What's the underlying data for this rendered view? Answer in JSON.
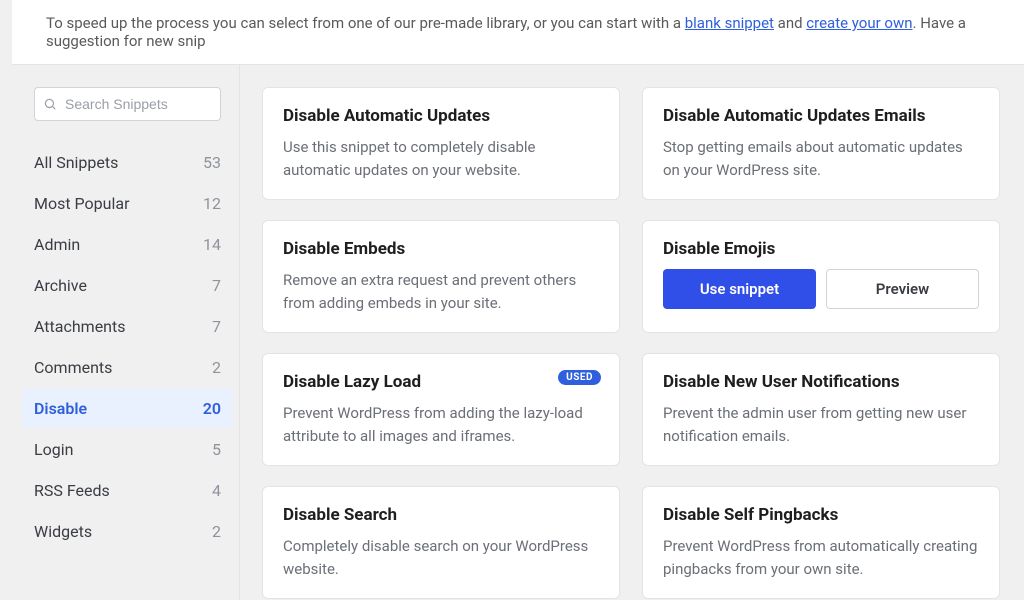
{
  "banner": {
    "prefix": "To speed up the process you can select from one of our pre-made library, or you can start with a ",
    "link1": "blank snippet",
    "mid": " and ",
    "link2": "create your own",
    "suffix": ". Have a suggestion for new snip"
  },
  "search": {
    "placeholder": "Search Snippets"
  },
  "categories": [
    {
      "label": "All Snippets",
      "count": "53",
      "active": false
    },
    {
      "label": "Most Popular",
      "count": "12",
      "active": false
    },
    {
      "label": "Admin",
      "count": "14",
      "active": false
    },
    {
      "label": "Archive",
      "count": "7",
      "active": false
    },
    {
      "label": "Attachments",
      "count": "7",
      "active": false
    },
    {
      "label": "Comments",
      "count": "2",
      "active": false
    },
    {
      "label": "Disable",
      "count": "20",
      "active": true
    },
    {
      "label": "Login",
      "count": "5",
      "active": false
    },
    {
      "label": "RSS Feeds",
      "count": "4",
      "active": false
    },
    {
      "label": "Widgets",
      "count": "2",
      "active": false
    }
  ],
  "cards": [
    {
      "title": "Disable Automatic Updates",
      "desc": "Use this snippet to completely disable automatic updates on your website.",
      "badge": "",
      "hovered": false
    },
    {
      "title": "Disable Automatic Updates Emails",
      "desc": "Stop getting emails about automatic updates on your WordPress site.",
      "badge": "",
      "hovered": false
    },
    {
      "title": "Disable Embeds",
      "desc": "Remove an extra request and prevent others from adding embeds in your site.",
      "badge": "",
      "hovered": false
    },
    {
      "title": "Disable Emojis",
      "desc": "",
      "badge": "",
      "hovered": true
    },
    {
      "title": "Disable Lazy Load",
      "desc": "Prevent WordPress from adding the lazy-load attribute to all images and iframes.",
      "badge": "USED",
      "hovered": false
    },
    {
      "title": "Disable New User Notifications",
      "desc": "Prevent the admin user from getting new user notification emails.",
      "badge": "",
      "hovered": false
    },
    {
      "title": "Disable Search",
      "desc": "Completely disable search on your WordPress website.",
      "badge": "",
      "hovered": false
    },
    {
      "title": "Disable Self Pingbacks",
      "desc": "Prevent WordPress from automatically creating pingbacks from your own site.",
      "badge": "",
      "hovered": false
    }
  ],
  "buttons": {
    "use": "Use snippet",
    "preview": "Preview"
  }
}
